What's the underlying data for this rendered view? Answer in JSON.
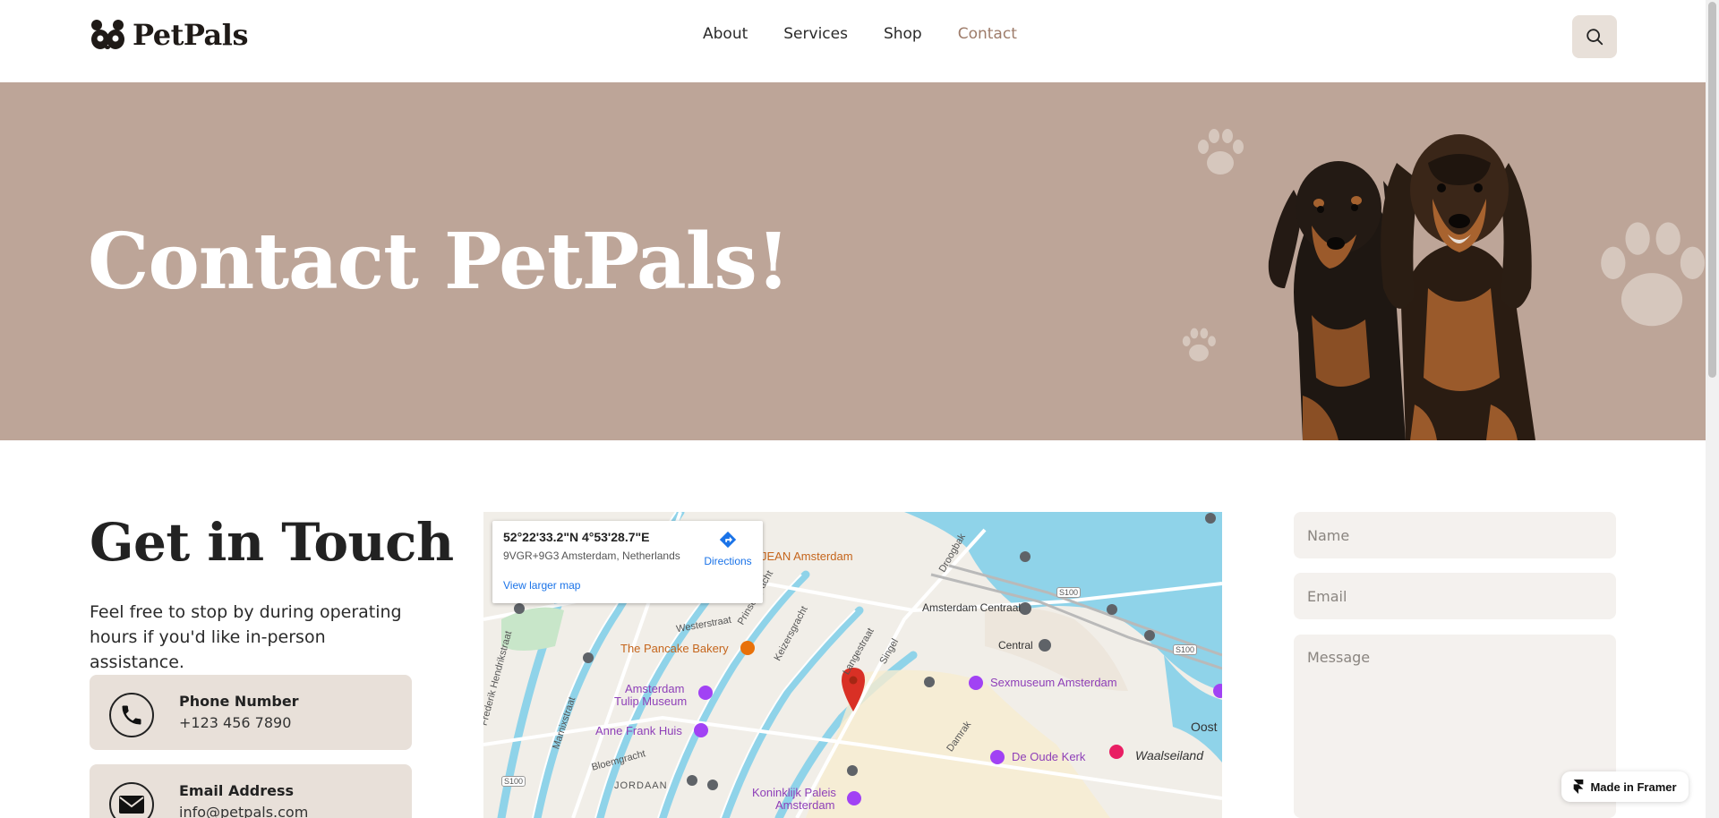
{
  "brand": {
    "name": "PetPals"
  },
  "nav": {
    "links": [
      {
        "label": "About"
      },
      {
        "label": "Services"
      },
      {
        "label": "Shop"
      },
      {
        "label": "Contact",
        "active": true
      }
    ],
    "search_icon": "search-icon"
  },
  "hero": {
    "title": "Contact PetPals!"
  },
  "contact": {
    "title": "Get in Touch",
    "description": "Feel free to stop by during operating hours if you'd like in-person assistance.",
    "cards": [
      {
        "icon": "phone-icon",
        "label": "Phone Number",
        "value": "+123 456 7890"
      },
      {
        "icon": "mail-icon",
        "label": "Email Address",
        "value": "info@petpals.com"
      }
    ]
  },
  "map": {
    "coordinates": "52°22'33.2\"N 4°53'28.7\"E",
    "address": "9VGR+9G3 Amsterdam, Netherlands",
    "view_larger": "View larger map",
    "directions": "Directions",
    "labels": {
      "pancake": "The Pancake Bakery",
      "tulip1": "Amsterdam",
      "tulip2": "Tulip Museum",
      "anne": "Anne Frank Huis",
      "centraal": "Amsterdam Centraal",
      "central": "Central",
      "sexmuseum": "Sexmuseum Amsterdam",
      "oudekerk": "De Oude Kerk",
      "waalseiland": "Waalseiland",
      "koninklijk1": "Koninklijk Paleis",
      "koninklijk2": "Amsterdam",
      "jordaan": "JORDAAN",
      "jean": "JEAN Amsterdam",
      "westerstraat": "Westerstraat",
      "prinsengracht": "Prinsengracht",
      "keizersgracht": "Keizersgracht",
      "langestraat": "Langestraat",
      "singel": "Singel",
      "marnixstraat": "Marnixstraat",
      "bloemgracht": "Bloemgracht",
      "damrak": "Damrak",
      "droogbak": "Droogbak",
      "oost": "Oost",
      "s100a": "S100",
      "s100b": "S100",
      "s100c": "S100",
      "hendrikstraat": "Frederik Hendrikstraat"
    }
  },
  "form": {
    "name_placeholder": "Name",
    "email_placeholder": "Email",
    "message_placeholder": "Message"
  },
  "badge": {
    "label": "Made in Framer"
  },
  "colors": {
    "hero_bg": "#bda598",
    "card_bg": "#e8e0d9",
    "accent": "#9e7c6a",
    "field_bg": "#f4f1ee"
  }
}
